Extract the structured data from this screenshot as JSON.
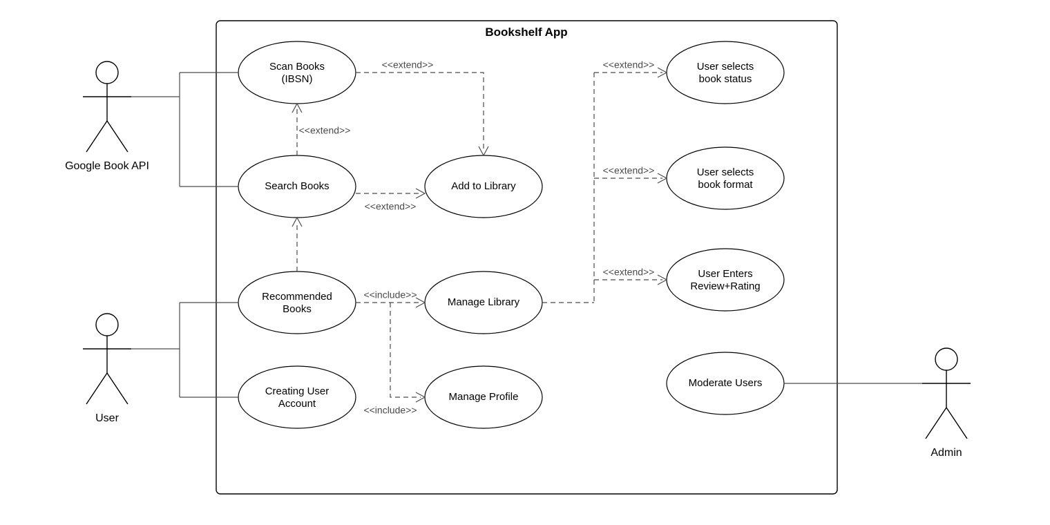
{
  "system": {
    "title": "Bookshelf App"
  },
  "actors": {
    "api": {
      "label": "Google Book API"
    },
    "user": {
      "label": "User"
    },
    "admin": {
      "label": "Admin"
    }
  },
  "usecases": {
    "scan": {
      "line1": "Scan Books",
      "line2": "(IBSN)"
    },
    "search": {
      "line1": "Search Books"
    },
    "recommend": {
      "line1": "Recommended",
      "line2": "Books"
    },
    "create": {
      "line1": "Creating User",
      "line2": "Account"
    },
    "addlib": {
      "line1": "Add to Library"
    },
    "mlib": {
      "line1": "Manage Library"
    },
    "mprof": {
      "line1": "Manage Profile"
    },
    "status": {
      "line1": "User selects",
      "line2": "book status"
    },
    "format": {
      "line1": "User selects",
      "line2": "book format"
    },
    "review": {
      "line1": "User Enters",
      "line2": "Review+Rating"
    },
    "moderate": {
      "line1": "Moderate Users"
    }
  },
  "labels": {
    "extend": "<<extend>>",
    "include": "<<include>>"
  }
}
